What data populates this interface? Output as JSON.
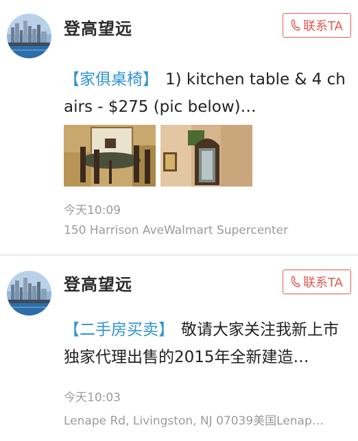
{
  "posts": [
    {
      "user_name": "登高望远",
      "contact_label": "联系TA",
      "category": "【家俱桌椅】",
      "text": "1) kitchen table & 4 chairs - $275 (pic below)…",
      "time": "今天10:09",
      "location": "150 Harrison AveWalmart Supercenter"
    },
    {
      "user_name": "登高望远",
      "contact_label": "联系TA",
      "category": "【二手房买卖】",
      "text": "敬请大家关注我新上市独家代理出售的2015年全新建造…",
      "time": "今天10:03",
      "location": "Lenape Rd, Livingston, NJ 07039美国Lenap…"
    }
  ],
  "colors": {
    "accent_red": "#e05a52",
    "category_blue": "#2f93cf",
    "meta_gray": "#9b9b9b"
  }
}
